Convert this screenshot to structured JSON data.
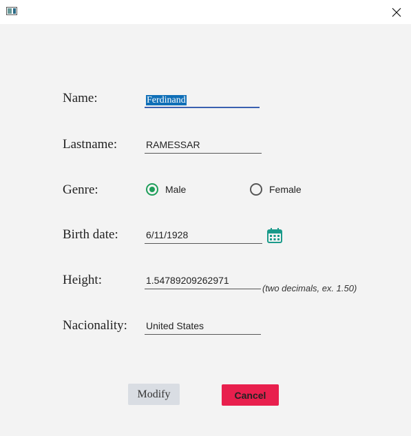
{
  "window": {
    "close_icon": "close-icon",
    "app_icon": "app-window-icon"
  },
  "form": {
    "name": {
      "label": "Name:",
      "value": "Ferdinand"
    },
    "lastname": {
      "label": "Lastname:",
      "value": "RAMESSAR"
    },
    "genre": {
      "label": "Genre:",
      "options": [
        {
          "label": "Male",
          "checked": true
        },
        {
          "label": "Female",
          "checked": false
        }
      ]
    },
    "birth_date": {
      "label": "Birth date:",
      "value": "6/11/1928",
      "icon": "calendar-icon"
    },
    "height": {
      "label": "Height:",
      "value": "1.54789209262971",
      "hint": "(two decimals, ex. 1.50)"
    },
    "nationality": {
      "label": "Nacionality:",
      "value": "United States"
    }
  },
  "buttons": {
    "modify": "Modify",
    "cancel": "Cancel"
  },
  "colors": {
    "accent_radio": "#1e9e5a",
    "cancel_bg": "#e81f4d",
    "modify_bg": "#d9dde3",
    "focus_underline": "#3a5fb0",
    "calendar_icon": "#1a9a8a"
  }
}
